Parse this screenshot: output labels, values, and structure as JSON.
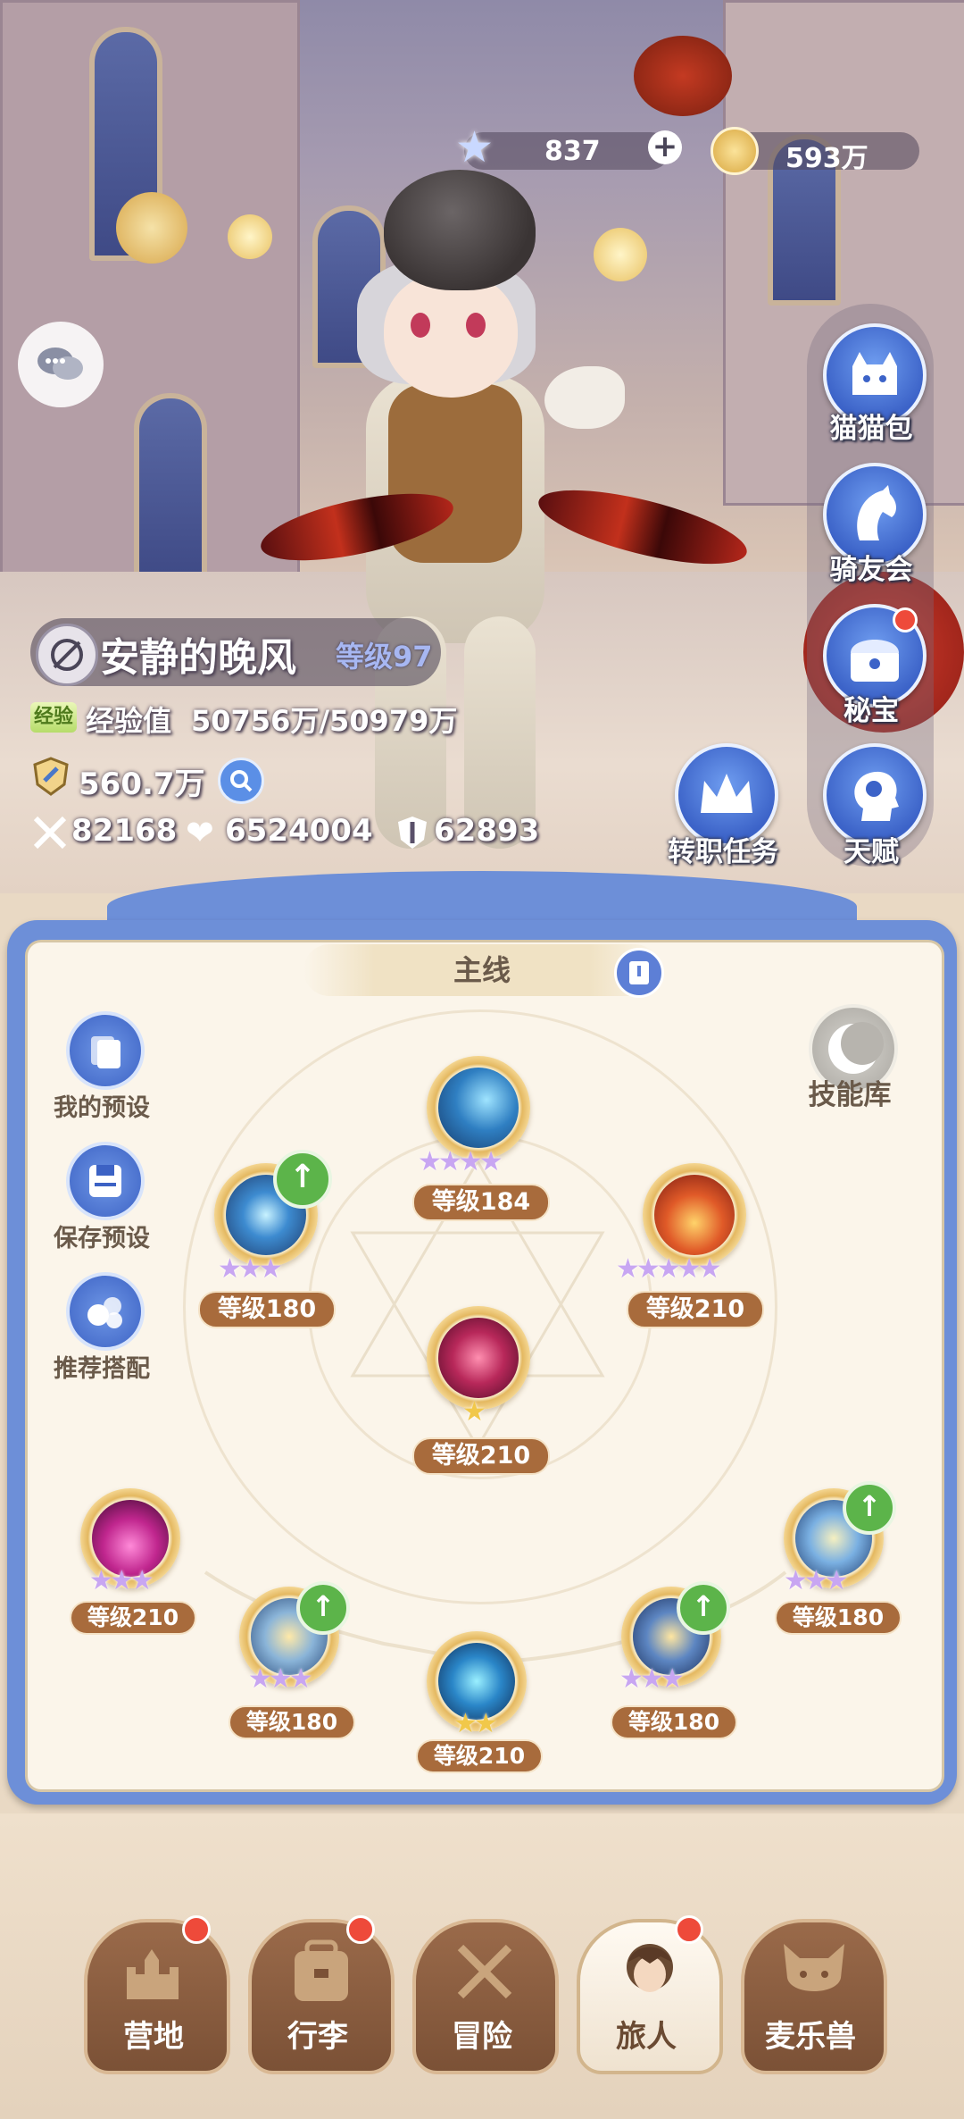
{
  "currency": {
    "gems": "837",
    "gold": "593万"
  },
  "player": {
    "name": "安静的晚风",
    "level_label": "等级97",
    "exp_badge": "经验",
    "exp_label": "经验值",
    "exp_value": "50756万/50979万",
    "power": "560.7万",
    "attack": "82168",
    "hp": "6524004",
    "defense": "62893"
  },
  "right_menu": [
    {
      "label": "猫猫包",
      "icon": "cat-bag-icon"
    },
    {
      "label": "骑友会",
      "icon": "horse-icon"
    },
    {
      "label": "秘宝",
      "icon": "treasure-chest-icon",
      "badge": true
    },
    {
      "label": "天赋",
      "icon": "brain-head-icon"
    }
  ],
  "job_quest": {
    "label": "转职任务",
    "icon": "crown-icon"
  },
  "panel": {
    "tab_title": "主线",
    "side": [
      {
        "label": "我的预设",
        "icon": "cards-icon"
      },
      {
        "label": "保存预设",
        "icon": "save-icon"
      },
      {
        "label": "推荐搭配",
        "icon": "recommend-icon"
      }
    ],
    "skill_library": "技能库",
    "skills": [
      {
        "id": "top",
        "level": "等级184",
        "stars": "★★★★",
        "star_color": "purple",
        "upgrade": false
      },
      {
        "id": "upper-left",
        "level": "等级180",
        "stars": "★★★",
        "star_color": "purple",
        "upgrade": true
      },
      {
        "id": "upper-right",
        "level": "等级210",
        "stars": "★★★★★",
        "star_color": "purple",
        "upgrade": false
      },
      {
        "id": "center",
        "level": "等级210",
        "stars": "★",
        "star_color": "gold",
        "upgrade": false
      },
      {
        "id": "lower-far-left",
        "level": "等级210",
        "stars": "★★★",
        "star_color": "purple",
        "upgrade": false
      },
      {
        "id": "lower-left",
        "level": "等级180",
        "stars": "★★★",
        "star_color": "purple",
        "upgrade": true
      },
      {
        "id": "lower-center",
        "level": "等级210",
        "stars": "★★",
        "star_color": "gold",
        "upgrade": false
      },
      {
        "id": "lower-right",
        "level": "等级180",
        "stars": "★★★",
        "star_color": "purple",
        "upgrade": true
      },
      {
        "id": "lower-far-right",
        "level": "等级180",
        "stars": "★★★",
        "star_color": "purple",
        "upgrade": true
      }
    ]
  },
  "nav": [
    {
      "label": "营地",
      "badge": true,
      "active": false
    },
    {
      "label": "行李",
      "badge": true,
      "active": false
    },
    {
      "label": "冒险",
      "badge": false,
      "active": false
    },
    {
      "label": "旅人",
      "badge": true,
      "active": true
    },
    {
      "label": "麦乐兽",
      "badge": false,
      "active": false
    }
  ]
}
